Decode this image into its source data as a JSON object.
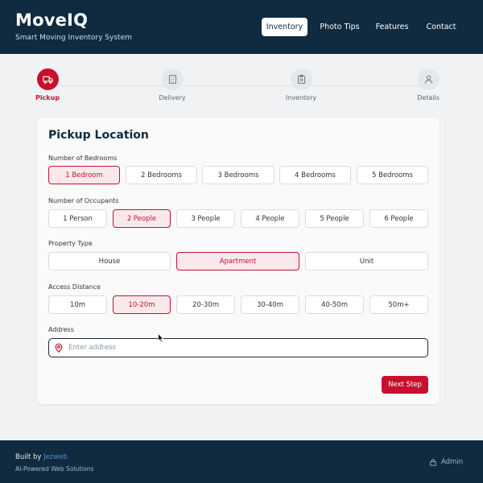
{
  "header": {
    "brand": "MoveIQ",
    "tagline": "Smart Moving Inventory System",
    "nav": [
      {
        "label": "Inventory",
        "active": true
      },
      {
        "label": "Photo Tips",
        "active": false
      },
      {
        "label": "Features",
        "active": false
      },
      {
        "label": "Contact",
        "active": false
      }
    ]
  },
  "stepper": {
    "steps": [
      {
        "label": "Pickup",
        "icon": "truck-icon",
        "active": true
      },
      {
        "label": "Delivery",
        "icon": "building-icon",
        "active": false
      },
      {
        "label": "Inventory",
        "icon": "clipboard-icon",
        "active": false
      },
      {
        "label": "Details",
        "icon": "user-icon",
        "active": false
      }
    ]
  },
  "form": {
    "title": "Pickup Location",
    "bedrooms": {
      "label": "Number of Bedrooms",
      "options": [
        "1 Bedroom",
        "2 Bedrooms",
        "3 Bedrooms",
        "4 Bedrooms",
        "5 Bedrooms"
      ],
      "selected": "1 Bedroom"
    },
    "occupants": {
      "label": "Number of Occupants",
      "options": [
        "1 Person",
        "2 People",
        "3 People",
        "4 People",
        "5 People",
        "6 People"
      ],
      "selected": "2 People"
    },
    "property": {
      "label": "Property Type",
      "options": [
        "House",
        "Apartment",
        "Unit"
      ],
      "selected": "Apartment"
    },
    "distance": {
      "label": "Access Distance",
      "options": [
        "10m",
        "10-20m",
        "20-30m",
        "30-40m",
        "40-50m",
        "50m+"
      ],
      "selected": "10-20m"
    },
    "address": {
      "label": "Address",
      "placeholder": "Enter address",
      "value": ""
    },
    "next_label": "Next Step"
  },
  "footer": {
    "built_prefix": "Built by",
    "built_link": "Jezweb",
    "subline": "AI-Powered Web Solutions",
    "admin_label": "Admin"
  },
  "colors": {
    "brand_navy": "#102b3f",
    "accent_red": "#c8102e",
    "link_blue": "#4a90d9"
  }
}
